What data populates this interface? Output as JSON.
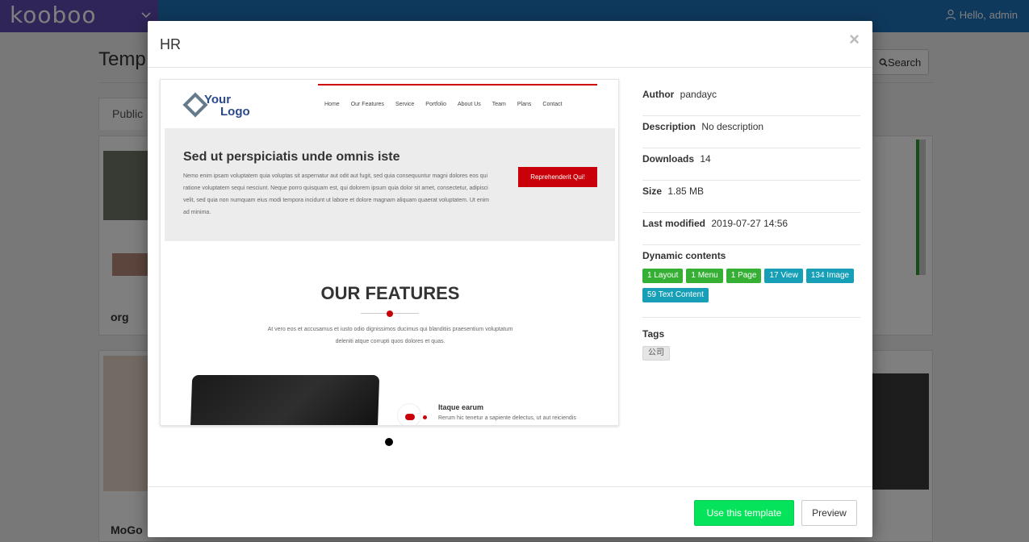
{
  "topbar": {
    "logo_text": "kooboo",
    "user_greeting": "Hello, admin"
  },
  "background": {
    "page_title": "Temp",
    "tab_public": "Public",
    "search_label": "Search",
    "card1_name": "org",
    "card2_name": "MoGo"
  },
  "modal": {
    "title": "HR",
    "close_label": "×",
    "preview": {
      "logo_line1": "Your",
      "logo_line2": "Logo",
      "nav": [
        "Home",
        "Our Features",
        "Service",
        "Portfolio",
        "About Us",
        "Team",
        "Plans",
        "Contact"
      ],
      "hero_title": "Sed ut perspiciatis unde omnis iste",
      "hero_text": "Nemo enim ipsam voluptatem quia voluptas sit aspernatur aut odit aut fugit, sed quia consequuntur magni dolores eos qui ratione voluptatem sequi nesciunt. Neque porro quisquam est, qui dolorem ipsum quia dolor sit amet, consectetur, adipisci velit, sed quia non numquam eius modi tempora incidunt ut labore et dolore magnam aliquam quaerat voluptatem. Ut enim ad minima.",
      "hero_button": "Reprehenderit Qui!",
      "features_title": "OUR FEATURES",
      "features_text": "At vero eos et accusamus et iusto odio dignissimos ducimus qui blanditiis praesentium voluptatum deleniti atque corrupti quos dolores et quas.",
      "feature_item_title": "Itaque earum",
      "feature_item_text": "Rerum hic tenetur a sapiente delectus, ut aut reiciendis"
    },
    "info": {
      "author_label": "Author",
      "author_value": "pandayc",
      "description_label": "Description",
      "description_value": "No description",
      "downloads_label": "Downloads",
      "downloads_value": "14",
      "size_label": "Size",
      "size_value": "1.85 MB",
      "modified_label": "Last modified",
      "modified_value": "2019-07-27 14:56",
      "dynamic_label": "Dynamic contents",
      "dynamic_badges": [
        {
          "text": "1 Layout",
          "color": "#35b034"
        },
        {
          "text": "1 Menu",
          "color": "#35b034"
        },
        {
          "text": "1 Page",
          "color": "#35b034"
        },
        {
          "text": "17 View",
          "color": "#169fb6"
        },
        {
          "text": "134 Image",
          "color": "#169fb6"
        },
        {
          "text": "59 Text Content",
          "color": "#169fb6"
        }
      ],
      "tags_label": "Tags",
      "tags": [
        "公司"
      ]
    },
    "footer": {
      "use_button": "Use this template",
      "preview_button": "Preview"
    }
  },
  "colors": {
    "topbar": "#1e73b8",
    "brand": "#5e4ab0",
    "use_button": "#04e35a",
    "accent_red": "#c9000a"
  }
}
